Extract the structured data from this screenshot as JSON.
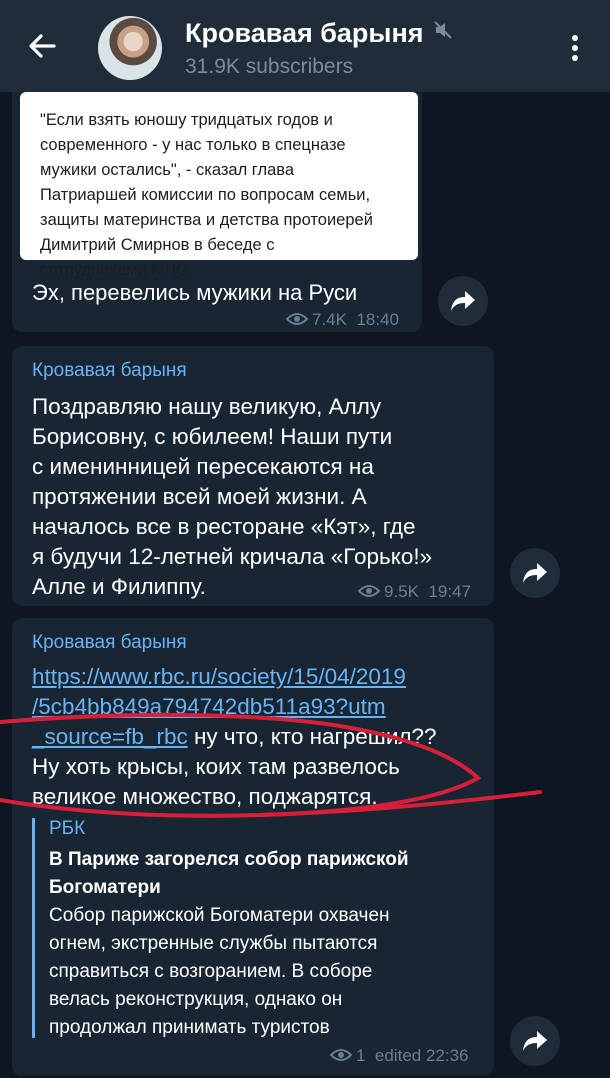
{
  "header": {
    "title": "Кровавая барыня",
    "subtitle": "31.9K subscribers",
    "back_icon": "arrow-left-icon",
    "mute_icon": "mute-icon",
    "menu_icon": "more-vertical-icon"
  },
  "messages": [
    {
      "preview_text": "\"Если взять юношу тридцатых годов и\nсовременного - у нас только в спецназе\nмужики остались\", - сказал глава\nПатриаршей комиссии по вопросам семьи,\nзащиты материнства и детства протоиерей\nДимитрий Смирнов в беседе с\nсотрудниками МЧС.",
      "text": "Эх, перевелись мужики на Руси",
      "views": "7.4K",
      "time": "18:40"
    },
    {
      "author": "Кровавая барыня",
      "text": "Поздравляю нашу великую, Аллу\nБорисовну, с юбилеем! Наши пути\nс именинницей пересекаются на\nпротяжении всей моей жизни. А\nначалось все в ресторане «Кэт», где\nя будучи 12-летней кричала «Горько!»\nАлле и Филиппу.",
      "views": "9.5K",
      "time": "19:47"
    },
    {
      "author": "Кровавая барыня",
      "link": "https://www.rbc.ru/society/15/04/2019\n/5cb4bb849a794742db511a93?utm\n_source=fb_rbc",
      "text_after_link": " ну что, кто нагрешил??\nНу хоть крысы, коих там развелось\nвеликое множество, поджарятся.",
      "preview_site": "РБК",
      "preview_title": "В Париже загорелся собор парижской\nБогоматери",
      "preview_desc": "Собор парижской Богоматери охвачен\nогнем, экстренные службы пытаются\nсправиться с возгоранием. В соборе\nвелась реконструкция, однако он\nпродолжал принимать туристов",
      "views": "1",
      "time": "edited 22:36"
    }
  ],
  "colors": {
    "background": "#0e1621",
    "bubble": "#182533",
    "header": "#1f2d3b",
    "accent": "#6ab3f3",
    "scribble": "#d81f3a"
  }
}
